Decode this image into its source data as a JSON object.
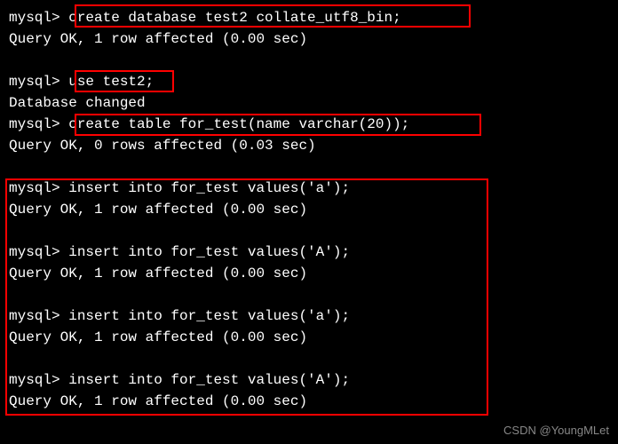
{
  "prompt": "mysql>",
  "lines": [
    {
      "type": "cmd",
      "text": "create database test2 collate_utf8_bin;"
    },
    {
      "type": "out",
      "text": "Query OK, 1 row affected (0.00 sec)"
    },
    {
      "type": "blank"
    },
    {
      "type": "cmd",
      "text": "use test2;"
    },
    {
      "type": "out",
      "text": "Database changed"
    },
    {
      "type": "cmd",
      "text": "create table for_test(name varchar(20));"
    },
    {
      "type": "out",
      "text": "Query OK, 0 rows affected (0.03 sec)"
    },
    {
      "type": "blank"
    },
    {
      "type": "cmd",
      "text": "insert into for_test values('a');"
    },
    {
      "type": "out",
      "text": "Query OK, 1 row affected (0.00 sec)"
    },
    {
      "type": "blank"
    },
    {
      "type": "cmd",
      "text": "insert into for_test values('A');"
    },
    {
      "type": "out",
      "text": "Query OK, 1 row affected (0.00 sec)"
    },
    {
      "type": "blank"
    },
    {
      "type": "cmd",
      "text": "insert into for_test values('a');"
    },
    {
      "type": "out",
      "text": "Query OK, 1 row affected (0.00 sec)"
    },
    {
      "type": "blank"
    },
    {
      "type": "cmd",
      "text": "insert into for_test values('A');"
    },
    {
      "type": "out",
      "text": "Query OK, 1 row affected (0.00 sec)"
    }
  ],
  "watermark": "CSDN @YoungMLet"
}
